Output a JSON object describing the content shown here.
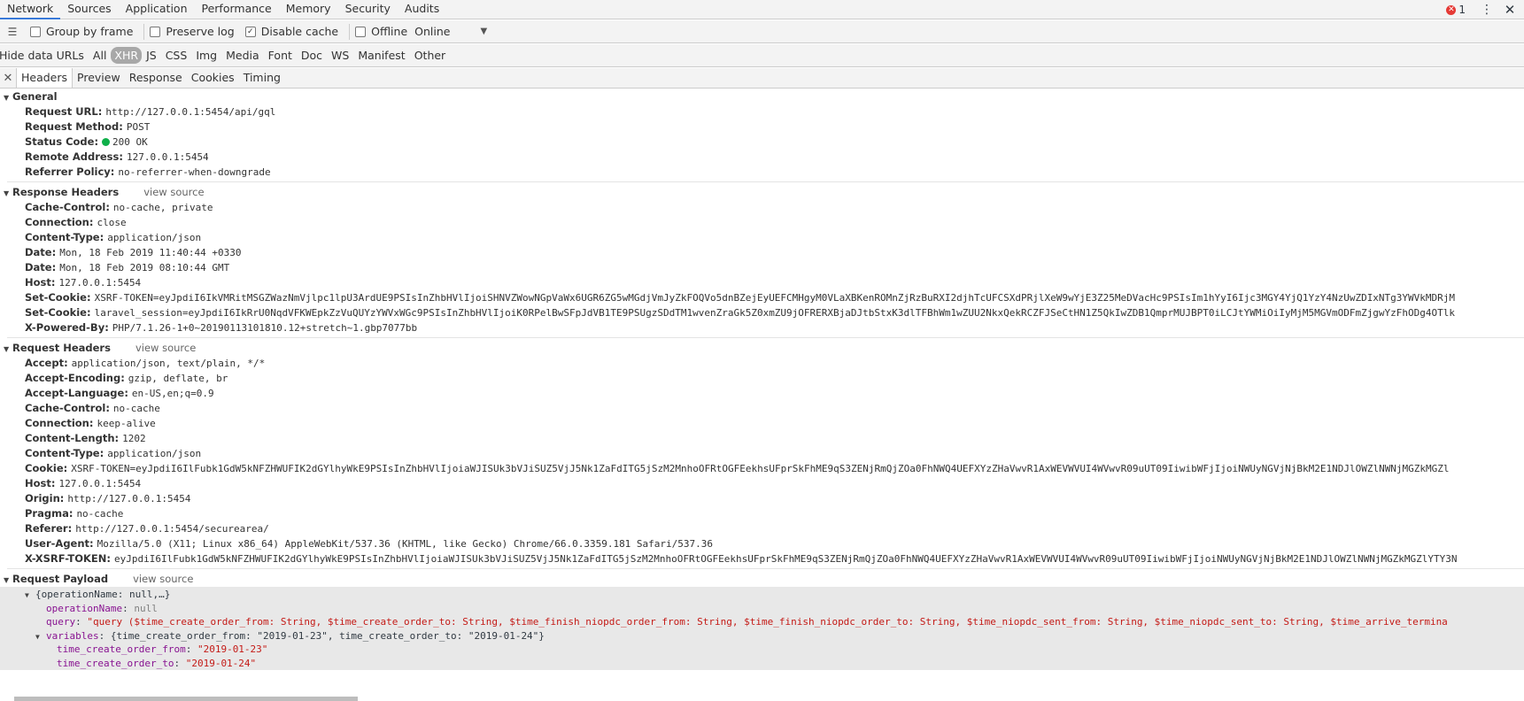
{
  "top_tabs": [
    "Network",
    "Sources",
    "Application",
    "Performance",
    "Memory",
    "Security",
    "Audits"
  ],
  "top_selected": 0,
  "error_count": "1",
  "toolbar": {
    "group_by_frame": "Group by frame",
    "preserve_log": "Preserve log",
    "disable_cache": "Disable cache",
    "offline": "Offline",
    "throttle": "Online"
  },
  "filters": [
    "Hide data URLs",
    "All",
    "XHR",
    "JS",
    "CSS",
    "Img",
    "Media",
    "Font",
    "Doc",
    "WS",
    "Manifest",
    "Other"
  ],
  "filter_selected": 2,
  "detail_tabs": [
    "Headers",
    "Preview",
    "Response",
    "Cookies",
    "Timing"
  ],
  "detail_selected": 0,
  "view_source": "view source",
  "general": {
    "title": "General",
    "rows": [
      {
        "k": "Request URL:",
        "v": "http://127.0.0.1:5454/api/gql"
      },
      {
        "k": "Request Method:",
        "v": "POST"
      },
      {
        "k": "Status Code:",
        "v": "200 OK"
      },
      {
        "k": "Remote Address:",
        "v": "127.0.0.1:5454"
      },
      {
        "k": "Referrer Policy:",
        "v": "no-referrer-when-downgrade"
      }
    ]
  },
  "response_headers": {
    "title": "Response Headers",
    "rows": [
      {
        "k": "Cache-Control:",
        "v": "no-cache, private"
      },
      {
        "k": "Connection:",
        "v": "close"
      },
      {
        "k": "Content-Type:",
        "v": "application/json"
      },
      {
        "k": "Date:",
        "v": "Mon, 18 Feb 2019 11:40:44 +0330"
      },
      {
        "k": "Date:",
        "v": "Mon, 18 Feb 2019 08:10:44 GMT"
      },
      {
        "k": "Host:",
        "v": "127.0.0.1:5454"
      },
      {
        "k": "Set-Cookie:",
        "v": "XSRF-TOKEN=eyJpdiI6IkVMRitMSGZWazNmVjlpc1lpU3ArdUE9PSIsInZhbHVlIjoiSHNVZWowNGpVaWx6UGR6ZG5wMGdjVmJyZkFOQVo5dnBZejEyUEFCMHgyM0VLaXBKenROMnZjRzBuRXI2djhTcUFCSXdPRjlXeW9wYjE3Z25MeDVacHc9PSIsIm1hYyI6Ijc3MGY4YjQ1YzY4NzUwZDIxNTg3YWVkMDRjM"
      },
      {
        "k": "Set-Cookie:",
        "v": "laravel_session=eyJpdiI6IkRrU0NqdVFKWEpkZzVuQUYzYWVxWGc9PSIsInZhbHVlIjoiK0RPelBwSFpJdVB1TE9PSUgzSDdTM1wvenZraGk5Z0xmZU9jOFRERXBjaDJtbStxK3dlTFBhWm1wZUU2NkxQekRCZFJSeCtHN1Z5QkIwZDB1QmprMUJBPT0iLCJtYWMiOiIyMjM5MGVmODFmZjgwYzFhODg4OTlk"
      },
      {
        "k": "X-Powered-By:",
        "v": "PHP/7.1.26-1+0~20190113101810.12+stretch~1.gbp7077bb"
      }
    ]
  },
  "request_headers": {
    "title": "Request Headers",
    "rows": [
      {
        "k": "Accept:",
        "v": "application/json, text/plain, */*"
      },
      {
        "k": "Accept-Encoding:",
        "v": "gzip, deflate, br"
      },
      {
        "k": "Accept-Language:",
        "v": "en-US,en;q=0.9"
      },
      {
        "k": "Cache-Control:",
        "v": "no-cache"
      },
      {
        "k": "Connection:",
        "v": "keep-alive"
      },
      {
        "k": "Content-Length:",
        "v": "1202"
      },
      {
        "k": "Content-Type:",
        "v": "application/json"
      },
      {
        "k": "Cookie:",
        "v": "XSRF-TOKEN=eyJpdiI6IlFubk1GdW5kNFZHWUFIK2dGYlhyWkE9PSIsInZhbHVlIjoiaWJISUk3bVJiSUZ5VjJ5Nk1ZaFdITG5jSzM2MnhoOFRtOGFEekhsUFprSkFhME9qS3ZENjRmQjZOa0FhNWQ4UEFXYzZHaVwvR1AxWEVWVUI4WVwvR09uUT09IiwibWFjIjoiNWUyNGVjNjBkM2E1NDJlOWZlNWNjMGZkMGZl"
      },
      {
        "k": "Host:",
        "v": "127.0.0.1:5454"
      },
      {
        "k": "Origin:",
        "v": "http://127.0.0.1:5454"
      },
      {
        "k": "Pragma:",
        "v": "no-cache"
      },
      {
        "k": "Referer:",
        "v": "http://127.0.0.1:5454/securearea/"
      },
      {
        "k": "User-Agent:",
        "v": "Mozilla/5.0 (X11; Linux x86_64) AppleWebKit/537.36 (KHTML, like Gecko) Chrome/66.0.3359.181 Safari/537.36"
      },
      {
        "k": "X-XSRF-TOKEN:",
        "v": "eyJpdiI6IlFubk1GdW5kNFZHWUFIK2dGYlhyWkE9PSIsInZhbHVlIjoiaWJISUk3bVJiSUZ5VjJ5Nk1ZaFdITG5jSzM2MnhoOFRtOGFEekhsUFprSkFhME9qS3ZENjRmQjZOa0FhNWQ4UEFXYzZHaVwvR1AxWEVWVUI4WVwvR09uUT09IiwibWFjIjoiNWUyNGVjNjBkM2E1NDJlOWZlNWNjMGZkMGZlYTY3N"
      }
    ]
  },
  "payload": {
    "title": "Request Payload",
    "root": "{operationName: null,…}",
    "operationName_key": "operationName",
    "operationName_val": "null",
    "query_key": "query",
    "query_val": "\"query ($time_create_order_from: String, $time_create_order_to: String, $time_finish_niopdc_order_from: String, $time_finish_niopdc_order_to: String, $time_niopdc_sent_from: String, $time_niopdc_sent_to: String, $time_arrive_termina",
    "variables_key": "variables",
    "variables_val": "{time_create_order_from: \"2019-01-23\", time_create_order_to: \"2019-01-24\"}",
    "var1_key": "time_create_order_from",
    "var1_val": "\"2019-01-23\"",
    "var2_key": "time_create_order_to",
    "var2_val": "\"2019-01-24\""
  }
}
